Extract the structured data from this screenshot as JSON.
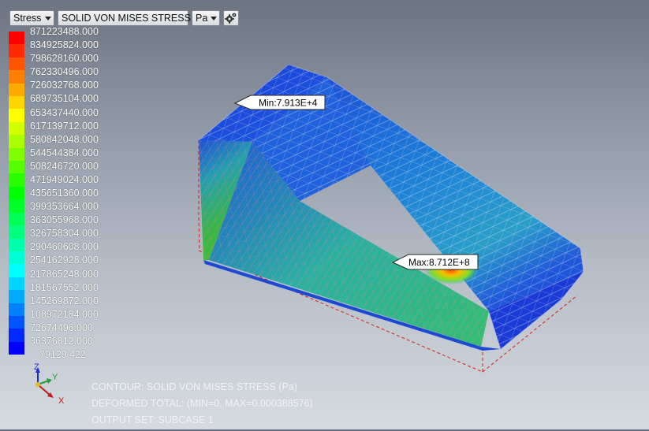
{
  "toolbar": {
    "result_type": "Stress",
    "result_component": "SOLID VON MISES STRESS",
    "unit": "Pa",
    "settings_icon": "gear-icon"
  },
  "legend": {
    "labels": [
      "871223488.000",
      "834925824.000",
      "798628160.000",
      "762330496.000",
      "726032768.000",
      "689735104.000",
      "653437440.000",
      "617139712.000",
      "580842048.000",
      "544544384.000",
      "508246720.000",
      "471949024.000",
      "435651360.000",
      "399353664.000",
      "363055968.000",
      "326758304.000",
      "290460608.000",
      "254162928.000",
      "217865248.000",
      "181567552.000",
      "145269872.000",
      "108972184.000",
      "72674496.000",
      "36376812.000",
      "79129.422"
    ],
    "colors": [
      "#ff0000",
      "#ff2a00",
      "#ff5500",
      "#ff7f00",
      "#ffaa00",
      "#ffd400",
      "#ffff00",
      "#d4ff00",
      "#aaff00",
      "#7fff00",
      "#55ff00",
      "#2aff00",
      "#00ff00",
      "#00ff2a",
      "#00ff55",
      "#00ff7f",
      "#00ffaa",
      "#00ffd4",
      "#00ffff",
      "#00d4ff",
      "#00aaff",
      "#007fff",
      "#0055ff",
      "#002aff",
      "#0000ff"
    ]
  },
  "markers": {
    "min": "Min:7.913E+4",
    "max": "Max:8.712E+8"
  },
  "info": {
    "line1": "CONTOUR: SOLID VON MISES STRESS (Pa)",
    "line2": "DEFORMED TOTAL: (MIN=0, MAX=0.000388576)",
    "line3": "OUTPUT SET: SUBCASE 1"
  },
  "triad": {
    "z": "Z",
    "y": "Y",
    "x": "X"
  }
}
